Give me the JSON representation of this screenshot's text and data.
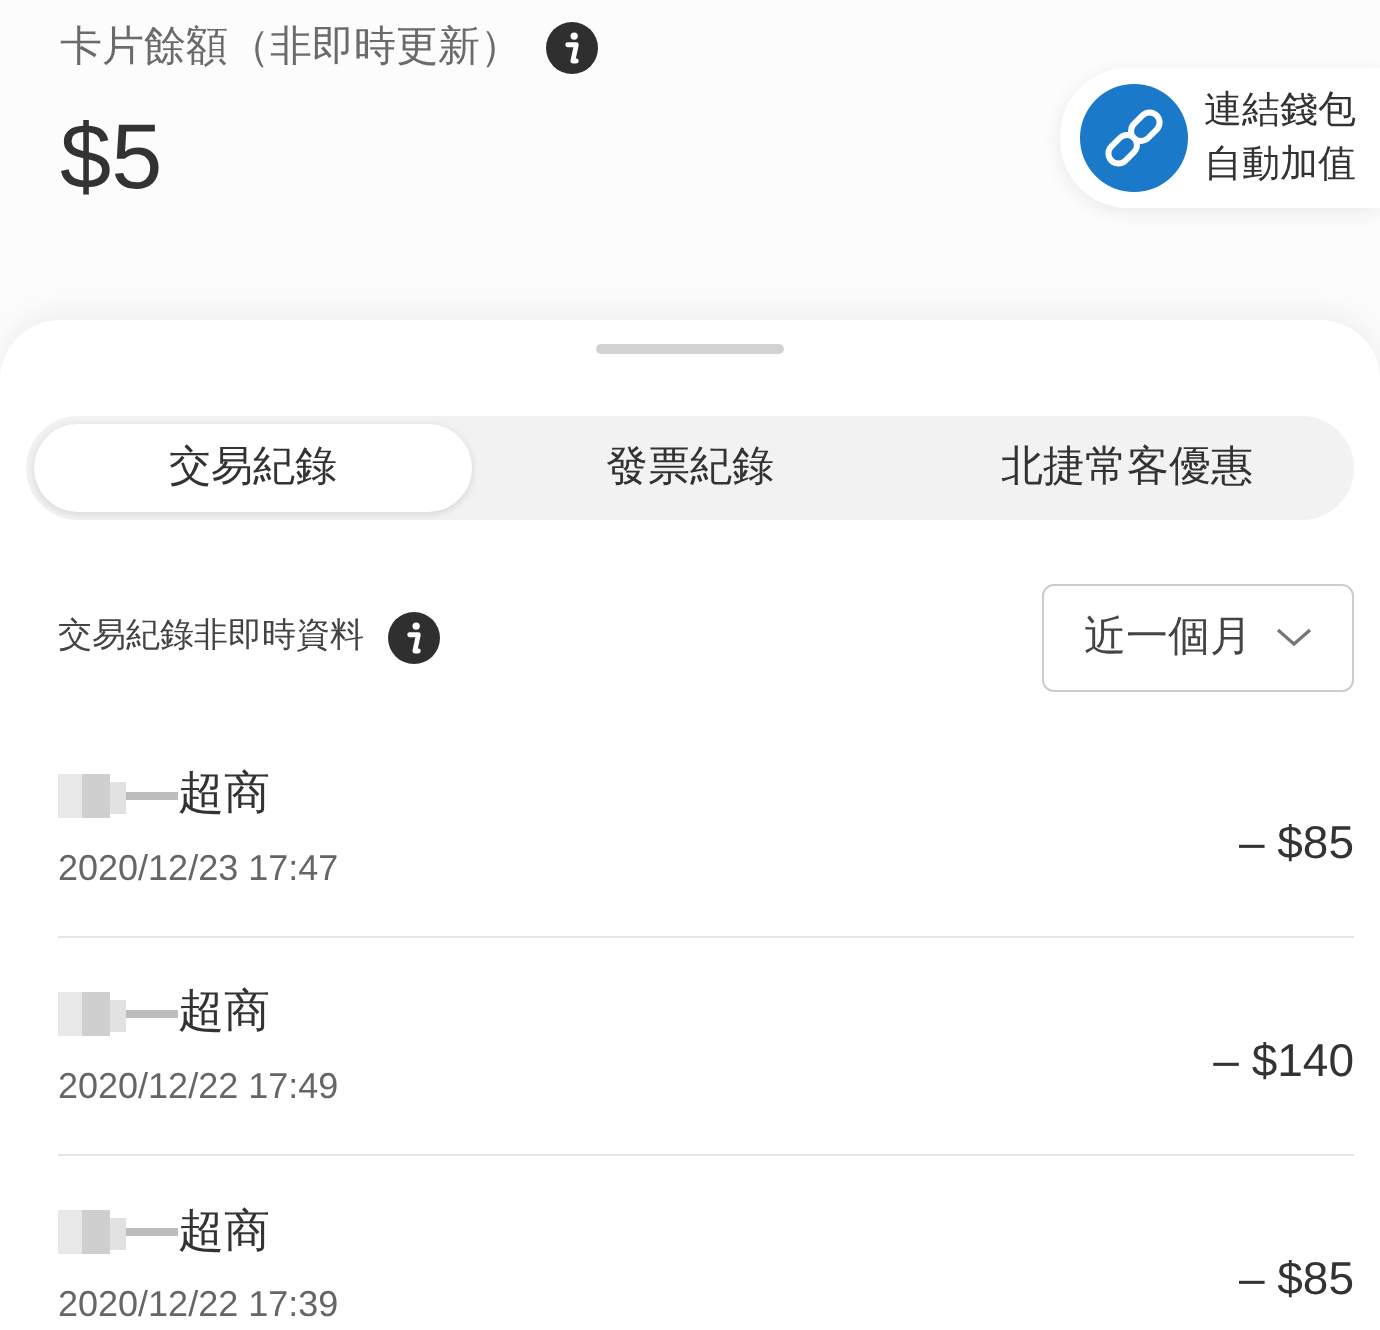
{
  "balance": {
    "label": "卡片餘額（非即時更新）",
    "amount": "$5"
  },
  "link_wallet": {
    "line1": "連結錢包",
    "line2": "自動加值"
  },
  "tabs": [
    {
      "label": "交易紀錄",
      "selected": true
    },
    {
      "label": "發票紀錄",
      "selected": false
    },
    {
      "label": "北捷常客優惠",
      "selected": false
    }
  ],
  "notice": "交易紀錄非即時資料",
  "period_dropdown": {
    "value": "近一個月"
  },
  "transactions": [
    {
      "merchant": "超商",
      "datetime": "2020/12/23 17:47",
      "amount": "– $85"
    },
    {
      "merchant": "超商",
      "datetime": "2020/12/22 17:49",
      "amount": "– $140"
    },
    {
      "merchant": "超商",
      "datetime": "2020/12/22 17:39",
      "amount": "– $85"
    }
  ]
}
